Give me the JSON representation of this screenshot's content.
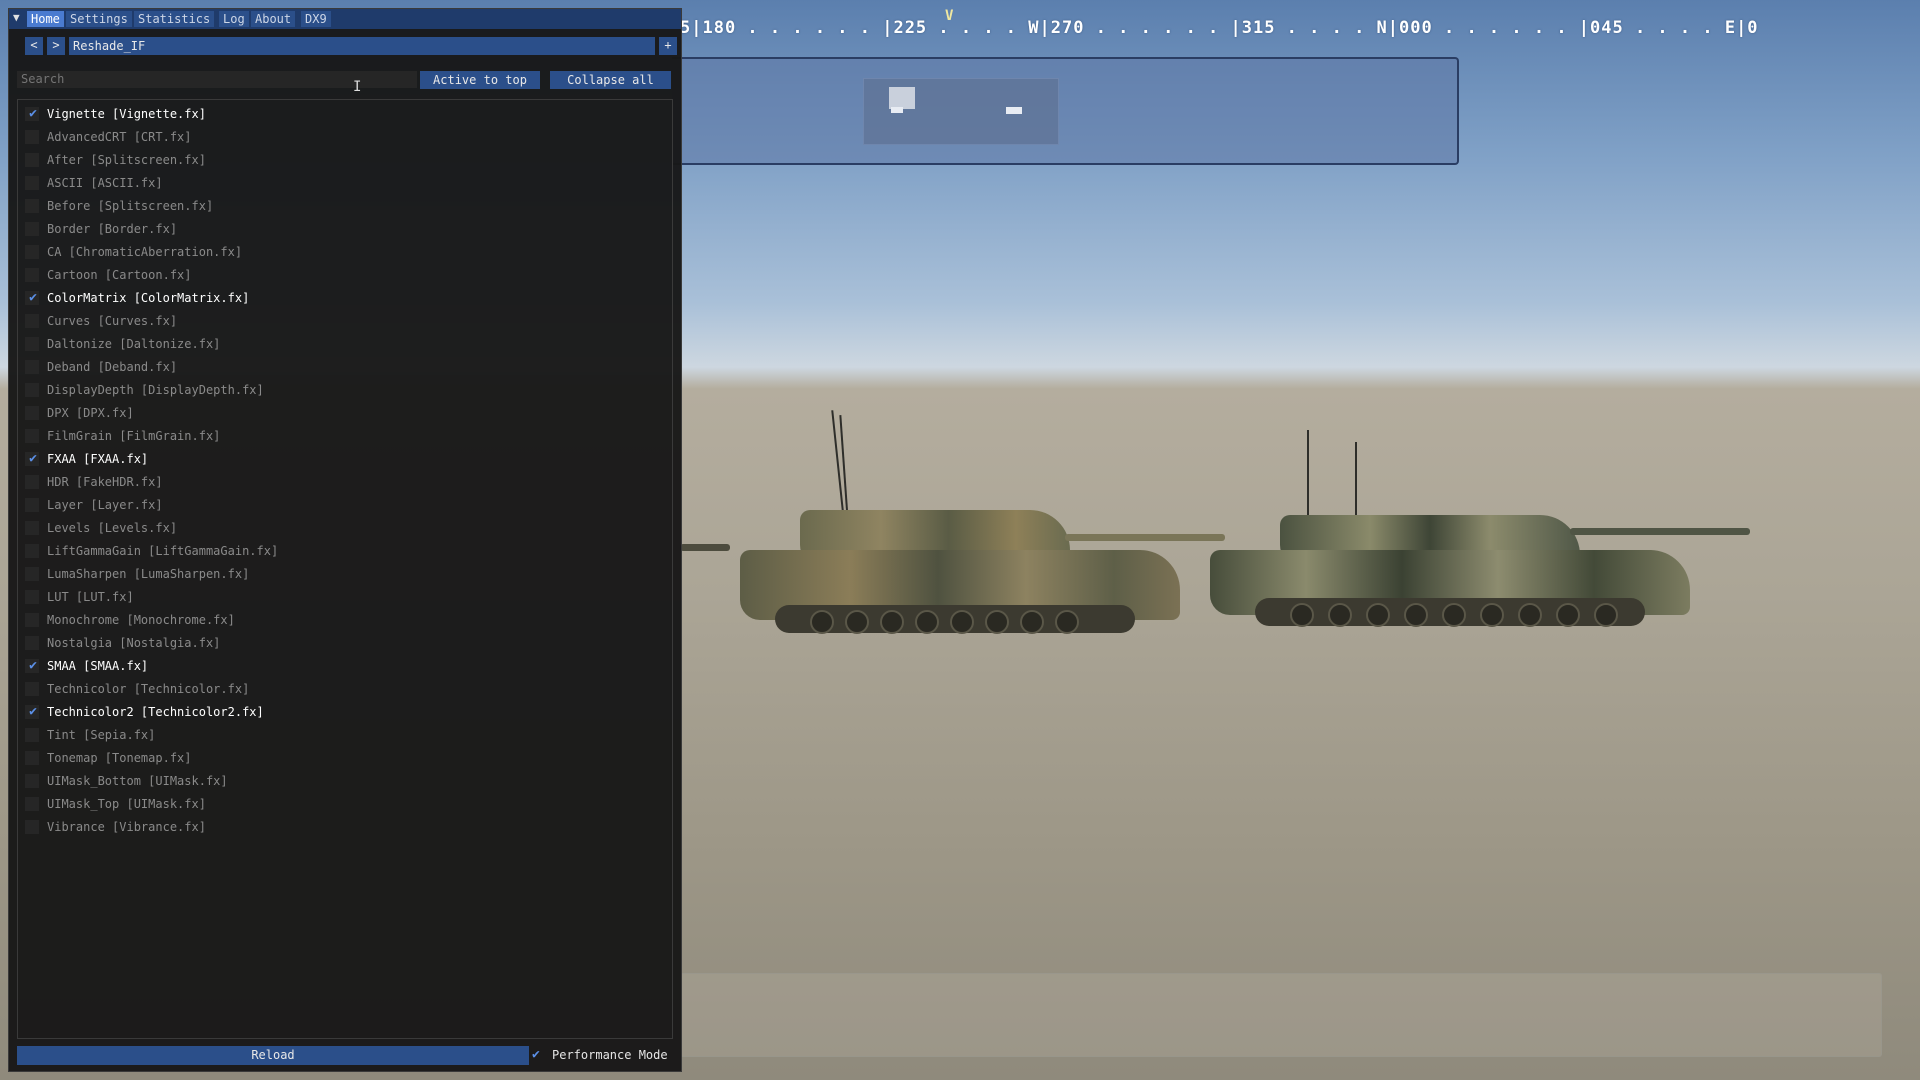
{
  "scene": {
    "compass_text": "5|180 . . . . . . |225 . . . . W|270 . . . . . . |315 . . . . N|000 . . . . . . |045 . . . . E|0",
    "compass_marker": "V"
  },
  "overlay": {
    "tabs": [
      {
        "label": "Home",
        "active": true
      },
      {
        "label": "Settings",
        "active": false
      },
      {
        "label": "Statistics",
        "active": false
      },
      {
        "label": "Log",
        "active": false
      },
      {
        "label": "About",
        "active": false
      },
      {
        "label": "DX9",
        "active": false
      }
    ],
    "toolbar": {
      "prev_label": "<",
      "next_label": ">",
      "preset_name": "Reshade_IF",
      "add_label": "+"
    },
    "search": {
      "placeholder": "Search",
      "value": ""
    },
    "active_to_top_label": "Active to top",
    "collapse_all_label": "Collapse all",
    "effects": [
      {
        "label": "Vignette [Vignette.fx]",
        "enabled": true
      },
      {
        "label": "AdvancedCRT [CRT.fx]",
        "enabled": false
      },
      {
        "label": "After [Splitscreen.fx]",
        "enabled": false
      },
      {
        "label": "ASCII [ASCII.fx]",
        "enabled": false
      },
      {
        "label": "Before [Splitscreen.fx]",
        "enabled": false
      },
      {
        "label": "Border [Border.fx]",
        "enabled": false
      },
      {
        "label": "CA [ChromaticAberration.fx]",
        "enabled": false
      },
      {
        "label": "Cartoon [Cartoon.fx]",
        "enabled": false
      },
      {
        "label": "ColorMatrix [ColorMatrix.fx]",
        "enabled": true
      },
      {
        "label": "Curves [Curves.fx]",
        "enabled": false
      },
      {
        "label": "Daltonize [Daltonize.fx]",
        "enabled": false
      },
      {
        "label": "Deband [Deband.fx]",
        "enabled": false
      },
      {
        "label": "DisplayDepth [DisplayDepth.fx]",
        "enabled": false
      },
      {
        "label": "DPX [DPX.fx]",
        "enabled": false
      },
      {
        "label": "FilmGrain [FilmGrain.fx]",
        "enabled": false
      },
      {
        "label": "FXAA [FXAA.fx]",
        "enabled": true
      },
      {
        "label": "HDR [FakeHDR.fx]",
        "enabled": false
      },
      {
        "label": "Layer [Layer.fx]",
        "enabled": false
      },
      {
        "label": "Levels [Levels.fx]",
        "enabled": false
      },
      {
        "label": "LiftGammaGain [LiftGammaGain.fx]",
        "enabled": false
      },
      {
        "label": "LumaSharpen [LumaSharpen.fx]",
        "enabled": false
      },
      {
        "label": "LUT [LUT.fx]",
        "enabled": false
      },
      {
        "label": "Monochrome [Monochrome.fx]",
        "enabled": false
      },
      {
        "label": "Nostalgia [Nostalgia.fx]",
        "enabled": false
      },
      {
        "label": "SMAA [SMAA.fx]",
        "enabled": true
      },
      {
        "label": "Technicolor [Technicolor.fx]",
        "enabled": false
      },
      {
        "label": "Technicolor2 [Technicolor2.fx]",
        "enabled": true
      },
      {
        "label": "Tint [Sepia.fx]",
        "enabled": false
      },
      {
        "label": "Tonemap [Tonemap.fx]",
        "enabled": false
      },
      {
        "label": "UIMask_Bottom [UIMask.fx]",
        "enabled": false
      },
      {
        "label": "UIMask_Top [UIMask.fx]",
        "enabled": false
      },
      {
        "label": "Vibrance [Vibrance.fx]",
        "enabled": false
      }
    ],
    "reload_label": "Reload",
    "performance_mode": {
      "label": "Performance Mode",
      "checked": true
    }
  },
  "colors": {
    "accent": "#2b4f8a",
    "accent_active": "#4a7bd0",
    "checkmark": "#5b8fe6",
    "panel_bg": "#181818"
  }
}
